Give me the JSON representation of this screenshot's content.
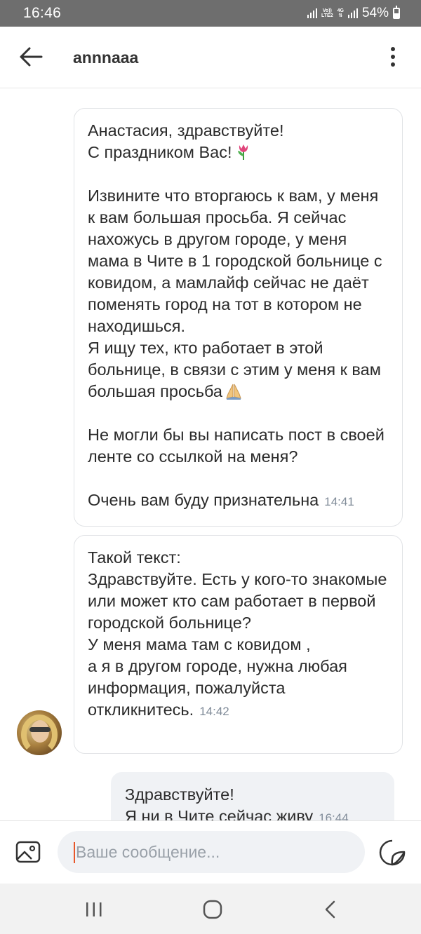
{
  "status_bar": {
    "time": "16:46",
    "network_top": "Vo))",
    "network_bottom": "LTE2",
    "network_gen": "4G",
    "battery": "54%"
  },
  "header": {
    "title": "annnaaa",
    "back_icon": "arrow-left-icon",
    "menu_icon": "more-vertical-icon"
  },
  "messages": [
    {
      "lines_a": "Анастасия, здравствуйте!",
      "lines_b": "С праздником Вас!",
      "emoji_b": "tulip-emoji",
      "para2": "Извините что вторгаюсь к вам, у меня к вам большая просьба. Я сейчас нахожусь в другом городе, у меня мама в Чите в 1 городской больнице с ковидом, а мамлайф сейчас не даёт поменять город на тот в котором не находишься.\nЯ ищу тех, кто работает в этой больнице, в связи с этим у меня к вам большая просьба",
      "emoji_para2": "folded-hands-emoji",
      "para3": "Не могли бы вы написать пост в своей ленте со ссылкой на меня?",
      "para4": "Очень вам буду признательна",
      "time": "14:41"
    },
    {
      "text": "Такой текст:\nЗдравствуйте. Есть у кого-то знакомые или может кто сам работает в первой городской больнице?\nУ меня мама там с ковидом ,\nа я в другом городе, нужна любая информация, пожалуйста откликнитесь.",
      "time": "14:42"
    },
    {
      "line1": "Здравствуйте!",
      "line2": "Я ни в Чите сейчас живу",
      "time": "16:44"
    }
  ],
  "composer": {
    "placeholder": "Ваше сообщение...",
    "attach_icon": "image-icon",
    "sticker_icon": "sticker-icon"
  },
  "nav": {
    "recents_icon": "recents-icon",
    "home_icon": "home-icon",
    "back_icon": "back-chevron-icon"
  },
  "colors": {
    "status_bar": "#6e6e6e",
    "bubble_border": "#e1e3e6",
    "outgoing_bubble": "#f0f2f5",
    "time_text": "#818c99",
    "caret": "#e8572a"
  }
}
